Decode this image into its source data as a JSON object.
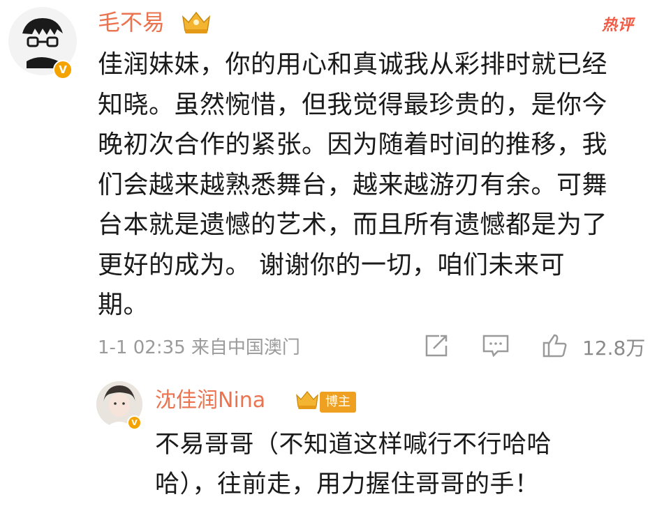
{
  "comment": {
    "username": "毛不易",
    "hot_tag": "热评",
    "verified_badge": "V",
    "text": "佳润妹妹，你的用心和真诚我从彩排时就已经\n知晓。虽然惋惜，但我觉得最珍贵的，是你今\n晚初次合作的紧张。因为随着时间的推移，我\n们会越来越熟悉舞台，越来越游刃有余。可舞\n台本就是遗憾的艺术，而且所有遗憾都是为了\n更好的成为。 谢谢你的一切，咱们未来可\n期。",
    "time_location": "1-1 02:35 来自中国澳门",
    "like_count": "12.8万",
    "icons": {
      "share": "share-icon",
      "comment": "comment-icon",
      "like": "thumbs-up-icon"
    }
  },
  "reply": {
    "username": "沈佳润Nina",
    "role_badge": "博主",
    "verified_badge": "V",
    "text": "不易哥哥（不知道这样喊行不行哈哈\n哈），往前走，用力握住哥哥的手！"
  },
  "colors": {
    "username": "#eb7350",
    "hot_tag": "#f25a44",
    "verified": "#f5a300",
    "badge": "#f0a020",
    "meta": "#9a9a9a"
  }
}
